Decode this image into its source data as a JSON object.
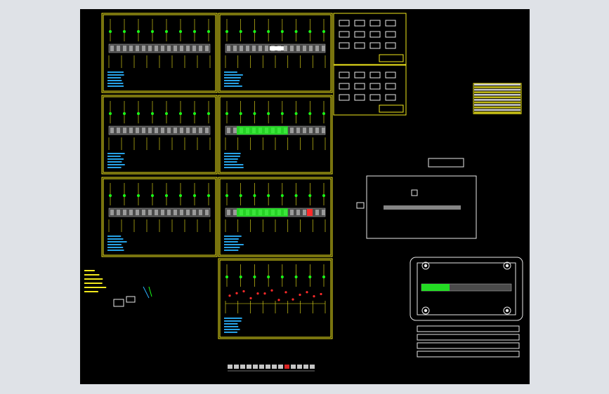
{
  "viewer": {
    "background_color": "#dfe2e7",
    "canvas_color": "#000000",
    "frame_color": "#f2e81c",
    "strip_color": "#4a4a4a",
    "note_color": "#2ab3ff",
    "highlight_color": "#19ff19",
    "alert_color": "#ff2a2a"
  },
  "drawing": {
    "sheets": [
      {
        "id": "sheet-1",
        "variant": "gray"
      },
      {
        "id": "sheet-2",
        "variant": "gray-white"
      },
      {
        "id": "sheet-3",
        "variant": "gray"
      },
      {
        "id": "sheet-4",
        "variant": "green"
      },
      {
        "id": "sheet-5",
        "variant": "gray"
      },
      {
        "id": "sheet-6",
        "variant": "green-red"
      },
      {
        "id": "sheet-7",
        "variant": "red-points"
      }
    ],
    "parts_list_sheets": 2,
    "bom_table_rows": 12,
    "die_plate_holes": 4,
    "die_plate_layers": 4,
    "icons": [
      "dimension-arrow-icon",
      "part-symbol-icon",
      "die-hole-icon"
    ]
  }
}
